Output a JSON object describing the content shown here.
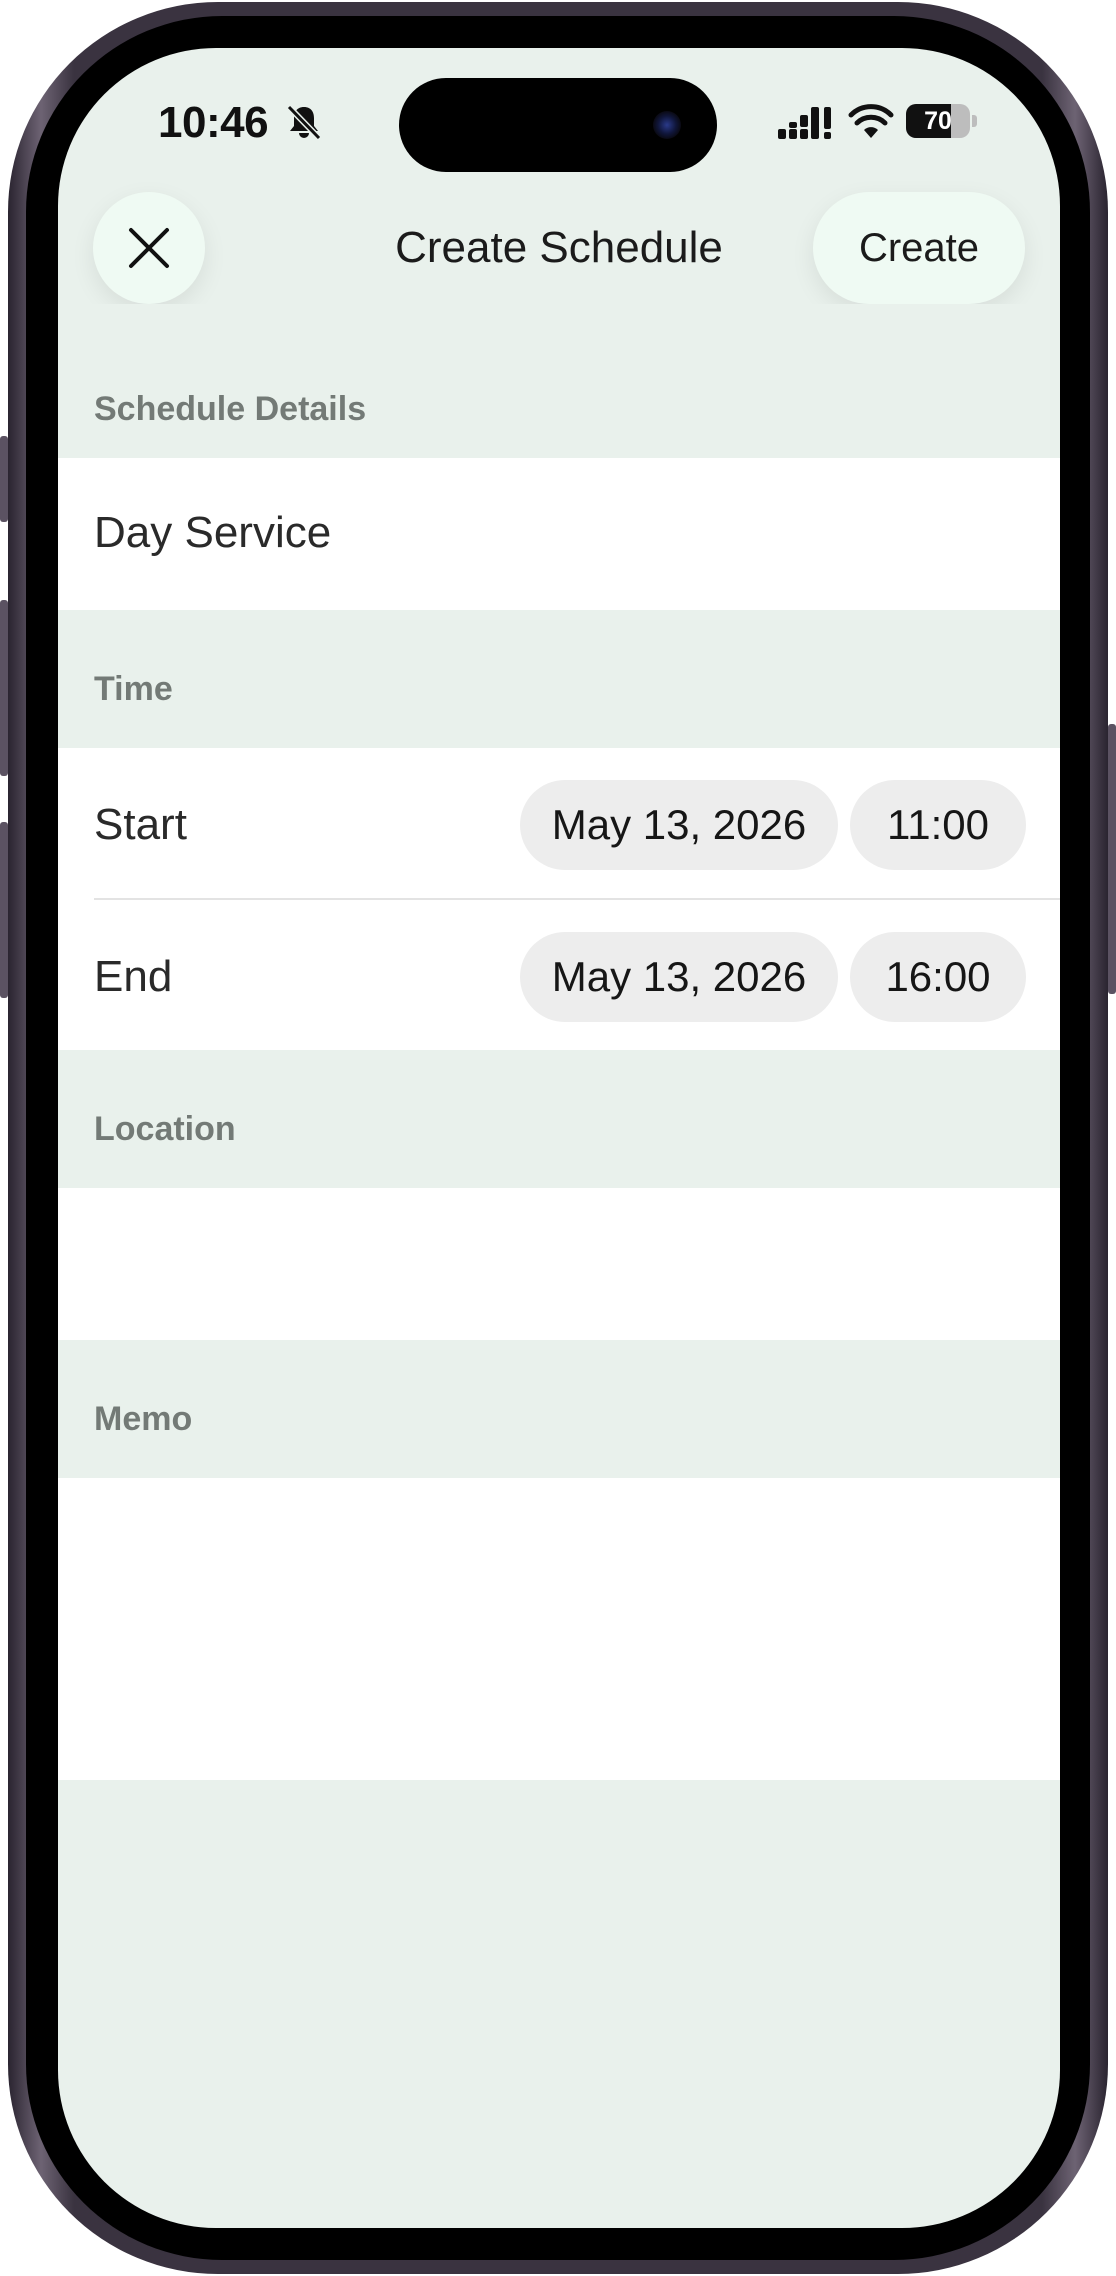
{
  "status": {
    "time": "10:46",
    "battery": "70",
    "battery_level": 0.7
  },
  "nav": {
    "title": "Create Schedule",
    "create_label": "Create"
  },
  "sections": {
    "details": {
      "header": "Schedule Details",
      "title_value": "Day Service"
    },
    "time": {
      "header": "Time",
      "start": {
        "label": "Start",
        "date": "May 13, 2026",
        "time": "11:00"
      },
      "end": {
        "label": "End",
        "date": "May 13, 2026",
        "time": "16:00"
      }
    },
    "location": {
      "header": "Location",
      "value": ""
    },
    "memo": {
      "header": "Memo",
      "value": ""
    }
  },
  "colors": {
    "background": "#e9f1ec",
    "button_bg": "#effaf3",
    "pill_bg": "#ededed",
    "section_header_text": "#737a76"
  }
}
